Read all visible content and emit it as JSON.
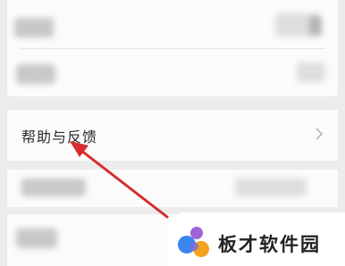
{
  "help_item": {
    "label": "帮助与反馈",
    "chevron_icon": "chevron-right-icon"
  },
  "watermark": {
    "text": "板才软件园",
    "logo_icon": "bancai-logo-icon"
  },
  "annotation": {
    "icon": "red-arrow-icon",
    "color": "#d62d2d"
  },
  "colors": {
    "background": "#ececec",
    "card": "#fbfbfb",
    "text": "#2a2a2a"
  }
}
